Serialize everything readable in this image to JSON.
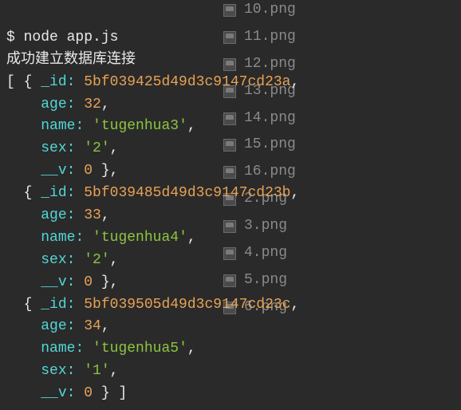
{
  "terminal": {
    "prompt": "$ ",
    "command": "node app.js",
    "message": "成功建立数据库连接",
    "open": "[ ",
    "close": " ]",
    "records": [
      {
        "id": "5bf039425d49d3c9147cd23a",
        "age": "32",
        "name": "'tugenhua3'",
        "sex": "'2'",
        "v": "0"
      },
      {
        "id": "5bf039485d49d3c9147cd23b",
        "age": "33",
        "name": "'tugenhua4'",
        "sex": "'2'",
        "v": "0"
      },
      {
        "id": "5bf039505d49d3c9147cd23c",
        "age": "34",
        "name": "'tugenhua5'",
        "sex": "'1'",
        "v": "0"
      }
    ],
    "labels": {
      "id": "_id",
      "age": "age",
      "name": "name",
      "sex": "sex",
      "v": "__v"
    }
  },
  "files": [
    "10.png",
    "11.png",
    "12.png",
    "13.png",
    "14.png",
    "15.png",
    "16.png",
    "2.png",
    "3.png",
    "4.png",
    "5.png",
    "6.png"
  ]
}
